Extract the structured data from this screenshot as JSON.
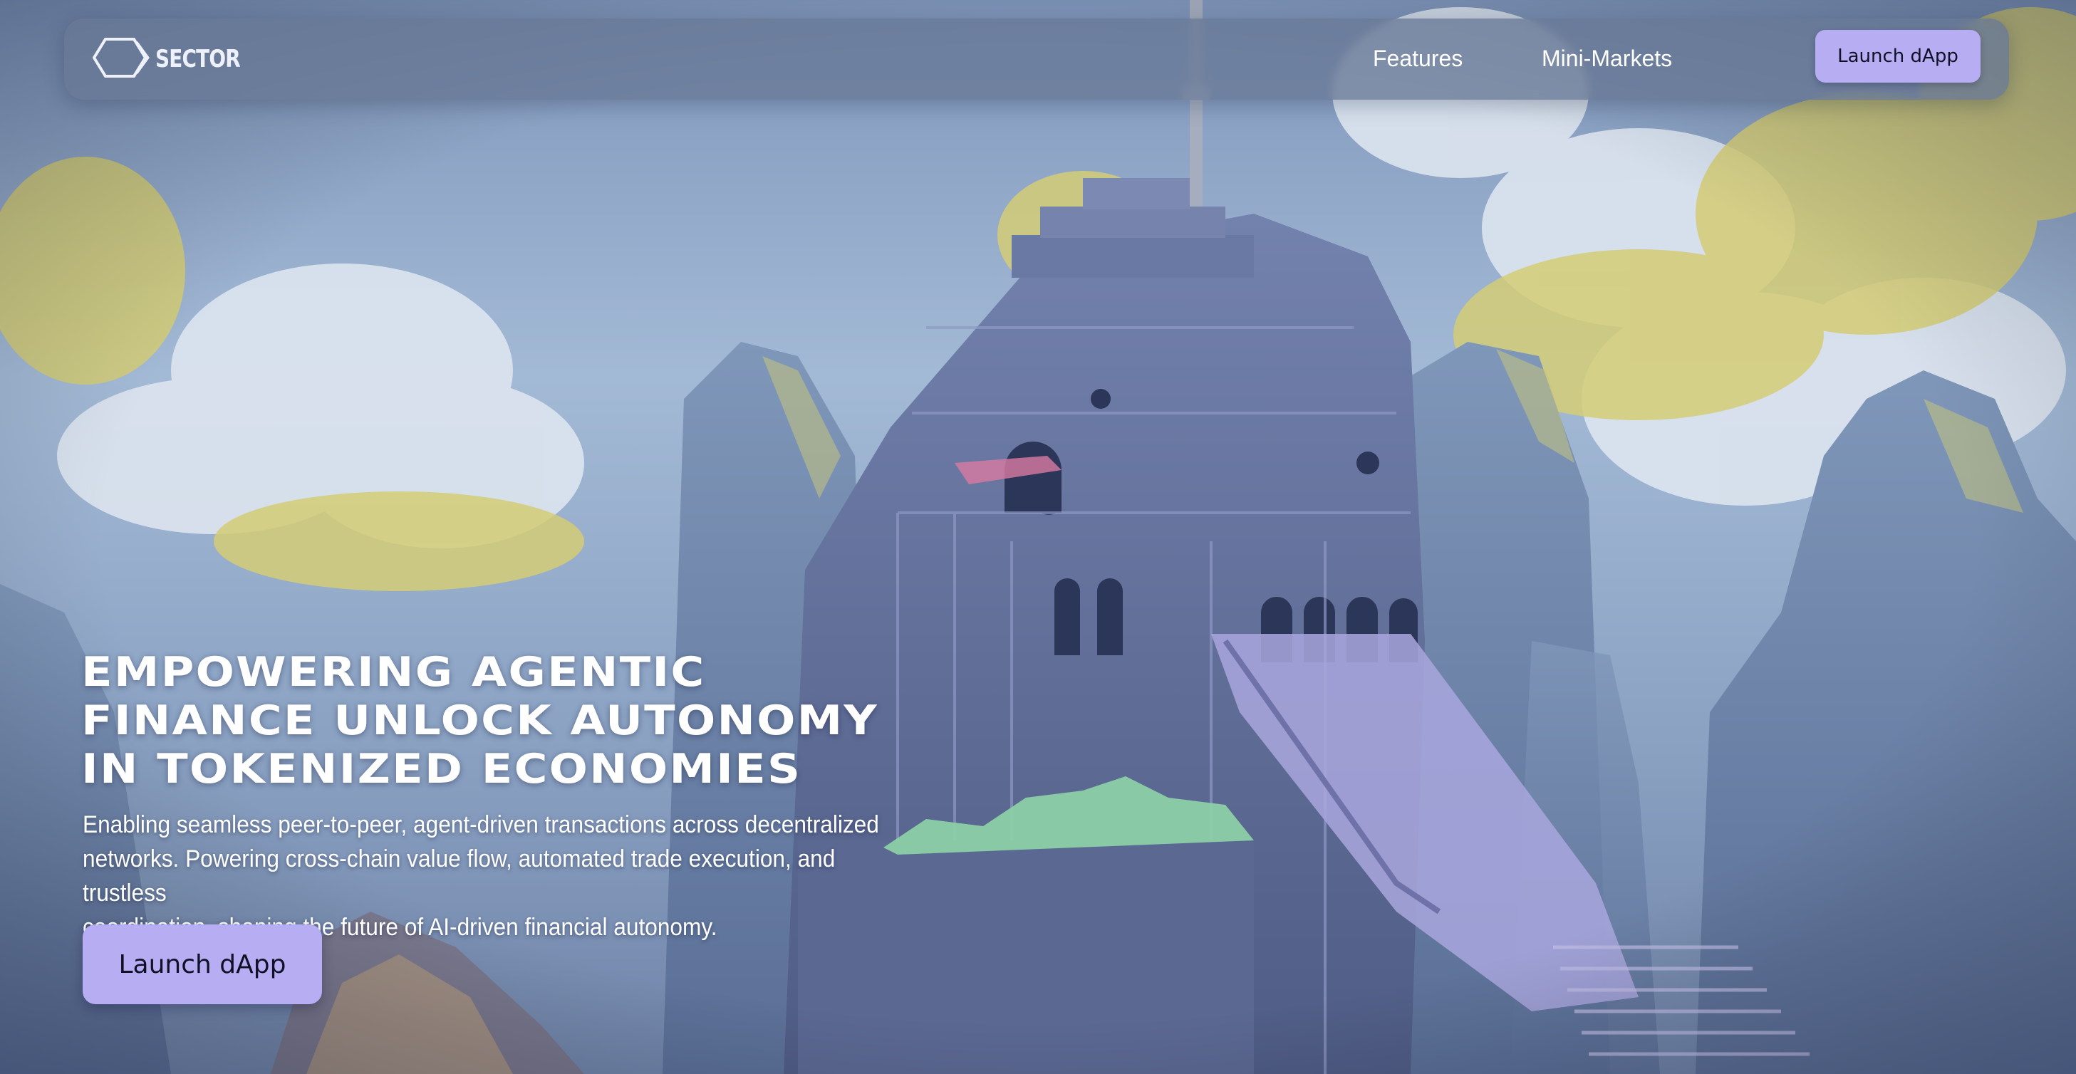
{
  "header": {
    "logo_text": "SECTOR",
    "logo_icon": "hexagon-arrow-icon",
    "nav_items": [
      {
        "label": "Features"
      },
      {
        "label": "Mini-Markets"
      }
    ],
    "cta_label": "Launch dApp"
  },
  "hero": {
    "title_lines": [
      "EMPOWERING AGENTIC",
      "FINANCE UNLOCK AUTONOMY",
      "IN TOKENIZED ECONOMIES"
    ],
    "subtitle_lines": [
      "Enabling seamless peer-to-peer, agent-driven transactions across decentralized",
      "networks. Powering cross-chain value flow, automated trade execution, and trustless",
      "coordination, shaping the future of AI-driven financial autonomy."
    ],
    "cta_label": "Launch dApp"
  },
  "colors": {
    "accent": "#b7adf3",
    "sky": "#8aa4c8",
    "building": "#5d6c96",
    "cloud_yellow": "#d6cf7a",
    "navbar": "#687896"
  }
}
